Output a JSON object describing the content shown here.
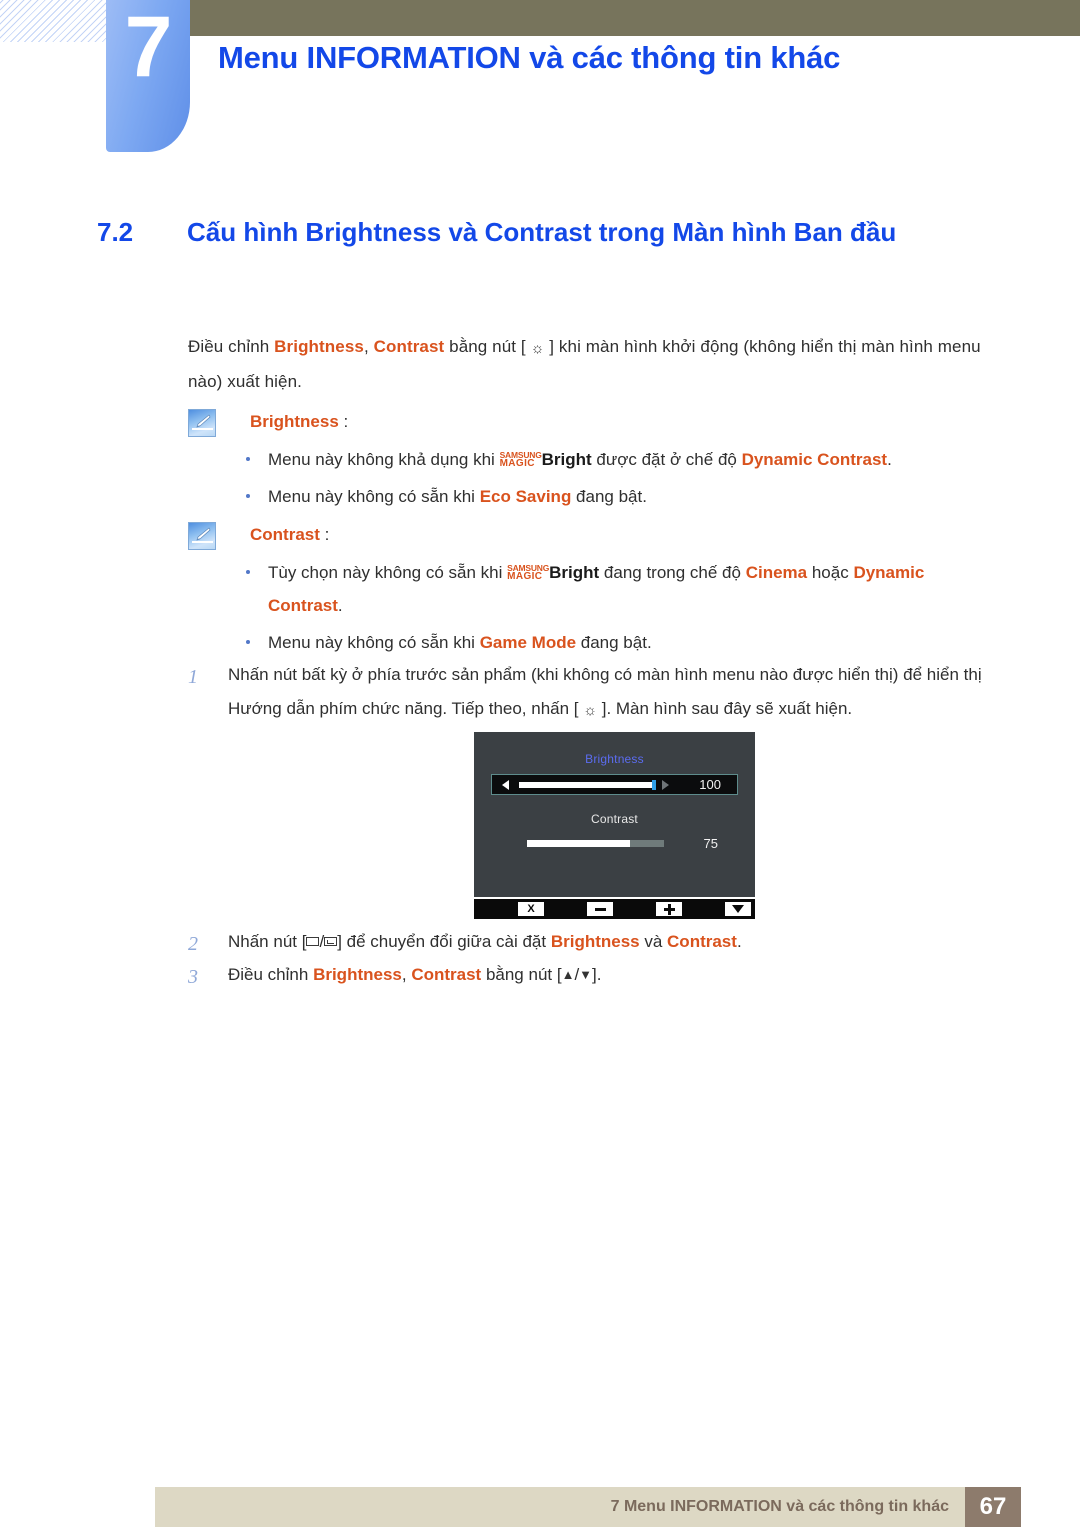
{
  "header": {
    "chapter_number": "7",
    "title": "Menu INFORMATION và các thông tin khác",
    "title_color": "#1348e8",
    "bar_color": "#77745c"
  },
  "section": {
    "number": "7.2",
    "title": "Cấu hình Brightness và Contrast trong Màn hình Ban đầu"
  },
  "intro": {
    "t1": "Điều chỉnh ",
    "b1": "Brightness",
    "t2": ", ",
    "b2": "Contrast",
    "t3": " bằng nút [ ",
    "icon": "brightness-sun-icon",
    "icon_glyph": "☼",
    "t4": " ] khi màn hình khởi động (không hiển thị màn hình menu nào) xuất hiện."
  },
  "notes": [
    {
      "icon": "note-pen-icon",
      "title": "Brightness",
      "colon": " :",
      "bullets": [
        {
          "t1": "Menu này không khả dụng khi ",
          "logo_top": "SAMSUNG",
          "logo_bottom": "MAGIC",
          "logo_suffix": "Bright",
          "t2": " được đặt ở chế độ ",
          "hl": "Dynamic Contrast",
          "t3": "."
        },
        {
          "t1": "Menu này không có sẵn khi ",
          "hl": "Eco Saving",
          "t2": " đang bật."
        }
      ]
    },
    {
      "icon": "note-pen-icon",
      "title": "Contrast",
      "colon": " :",
      "bullets": [
        {
          "t1": "Tùy chọn này không có sẵn khi ",
          "logo_top": "SAMSUNG",
          "logo_bottom": "MAGIC",
          "logo_suffix": "Bright",
          "t2": " đang trong chế độ ",
          "hl": "Cinema",
          "t3": " hoặc ",
          "hl2": "Dynamic Contrast",
          "t4": "."
        },
        {
          "t1": "Menu này không có sẵn khi ",
          "hl": "Game Mode",
          "t2": " đang bật."
        }
      ]
    }
  ],
  "steps": [
    {
      "num": "1",
      "t1": "Nhấn nút bất kỳ ở phía trước sản phẩm (khi không có màn hình menu nào được hiển thị) để hiển thị Hướng dẫn phím chức năng. Tiếp theo, nhấn [ ",
      "icon_glyph": "☼",
      "t2": " ]. Màn hình sau đây sẽ xuất hiện."
    },
    {
      "num": "2",
      "t1": "Nhấn nút [",
      "sep": "/",
      "t2": "] để chuyển đổi giữa cài đặt ",
      "hl": "Brightness",
      "t3": " và ",
      "hl2": "Contrast",
      "t4": "."
    },
    {
      "num": "3",
      "t1": "Điều chỉnh ",
      "hl": "Brightness",
      "t2": ", ",
      "hl2": "Contrast",
      "t3": " bằng nút [",
      "up_glyph": "▲",
      "sep": "/",
      "down_glyph": "▼",
      "t4": "]."
    }
  ],
  "osd": {
    "brightness_label": "Brightness",
    "brightness_value": "100",
    "brightness_percent": 100,
    "brightness_label_color": "#5b6cf0",
    "contrast_label": "Contrast",
    "contrast_value": "75",
    "contrast_percent": 75,
    "panel_bg": "#3b4044",
    "buttons": [
      {
        "name": "close-button",
        "glyph": "X"
      },
      {
        "name": "minus-button",
        "glyph": ""
      },
      {
        "name": "plus-button",
        "glyph": ""
      },
      {
        "name": "down-button",
        "glyph": ""
      }
    ]
  },
  "footer": {
    "text": "7 Menu INFORMATION và các thông tin khác",
    "page_number": "67",
    "bar_color": "#ddd8c4",
    "pageno_color": "#8d7b6c"
  }
}
